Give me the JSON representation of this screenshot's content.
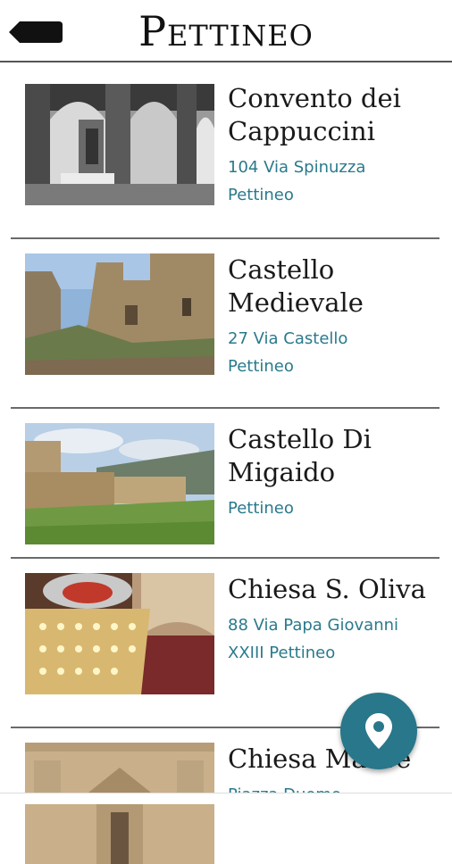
{
  "header": {
    "title": "Pettineo",
    "back_icon": "back-arrow-icon"
  },
  "places": [
    {
      "name": "Convento dei Cappuccini",
      "address_lines": [
        "104 Via Spinuzza",
        "Pettineo"
      ]
    },
    {
      "name": "Castello Medievale",
      "address_lines": [
        "27 Via Castello",
        "Pettineo"
      ]
    },
    {
      "name": "Castello Di Migaido",
      "address_lines": [
        "Pettineo"
      ]
    },
    {
      "name": "Chiesa S. Oliva",
      "address_lines": [
        "88 Via Papa Giovanni",
        "XXIII Pettineo"
      ]
    },
    {
      "name": "Chiesa Madre",
      "address_lines": [
        "Piazza Duomo"
      ]
    }
  ],
  "fab": {
    "icon": "map-pin-icon",
    "color": "#28778b"
  },
  "colors": {
    "accent_text": "#2a7a8c",
    "title_text": "#111111"
  }
}
